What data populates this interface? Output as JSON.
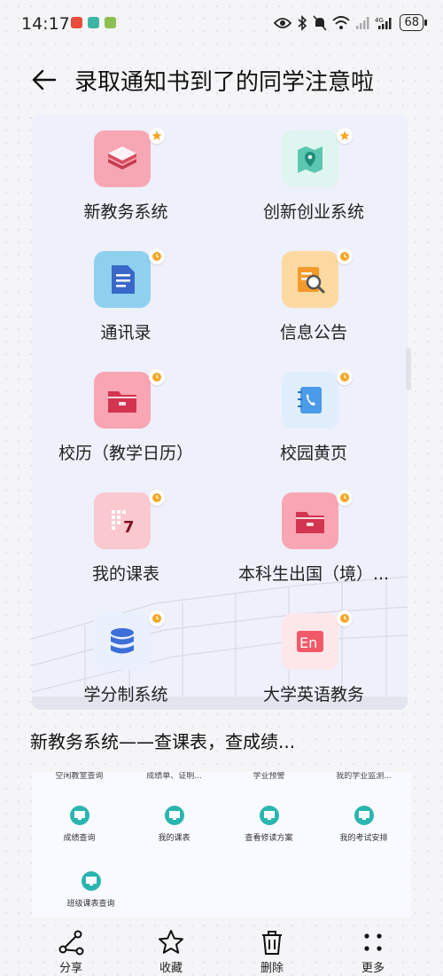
{
  "status_bar": {
    "time": "14:17",
    "battery": "68",
    "icons": [
      "app-icon-red",
      "app-icon-teal",
      "app-icon-green",
      "eye-icon",
      "bluetooth-icon",
      "mute-icon",
      "wifi-icon",
      "signal-icon",
      "4g-signal-icon",
      "battery-icon"
    ]
  },
  "header": {
    "title": "录取通知书到了的同学注意啦"
  },
  "apps": [
    {
      "label": "新教务系统",
      "icon": "layers-icon",
      "badge": "star",
      "color": "#f7a7b4"
    },
    {
      "label": "创新创业系统",
      "icon": "map-pin-icon",
      "badge": "star",
      "color": "#dff5ef"
    },
    {
      "label": "通讯录",
      "icon": "document-icon",
      "badge": "clock",
      "color": "#8fd0ef"
    },
    {
      "label": "信息公告",
      "icon": "search-doc-icon",
      "badge": "clock",
      "color": "#fcd9a1"
    },
    {
      "label": "校历（教学日历）",
      "icon": "folder-icon",
      "badge": "clock",
      "color": "#f8a6b3"
    },
    {
      "label": "校园黄页",
      "icon": "phone-book-icon",
      "badge": "clock",
      "color": "#e0eefc"
    },
    {
      "label": "我的课表",
      "icon": "calendar-icon",
      "badge": "clock",
      "color": "#f9c9cf"
    },
    {
      "label": "本科生出国（境）...",
      "icon": "folder-icon",
      "badge": "clock",
      "color": "#f8a6b3"
    },
    {
      "label": "学分制系统",
      "icon": "database-icon",
      "badge": "clock",
      "color": "#eaf0fd"
    },
    {
      "label": "大学英语教务",
      "icon": "en-icon",
      "badge": "clock",
      "color": "#fde7e9"
    }
  ],
  "subtitle": "新教务系统——查课表，查成绩...",
  "preview": {
    "cut_labels": [
      "空闲教室查询",
      "成绩单、证明...",
      "学业预警",
      "我的学业监测..."
    ],
    "items": [
      {
        "label": "成绩查询"
      },
      {
        "label": "我的课表"
      },
      {
        "label": "查看修读方案"
      },
      {
        "label": "我的考试安排"
      },
      {
        "label": "班级课表查询"
      }
    ]
  },
  "bottom_bar": [
    {
      "label": "分享",
      "icon": "share-icon"
    },
    {
      "label": "收藏",
      "icon": "star-icon"
    },
    {
      "label": "删除",
      "icon": "trash-icon"
    },
    {
      "label": "更多",
      "icon": "more-icon"
    }
  ]
}
